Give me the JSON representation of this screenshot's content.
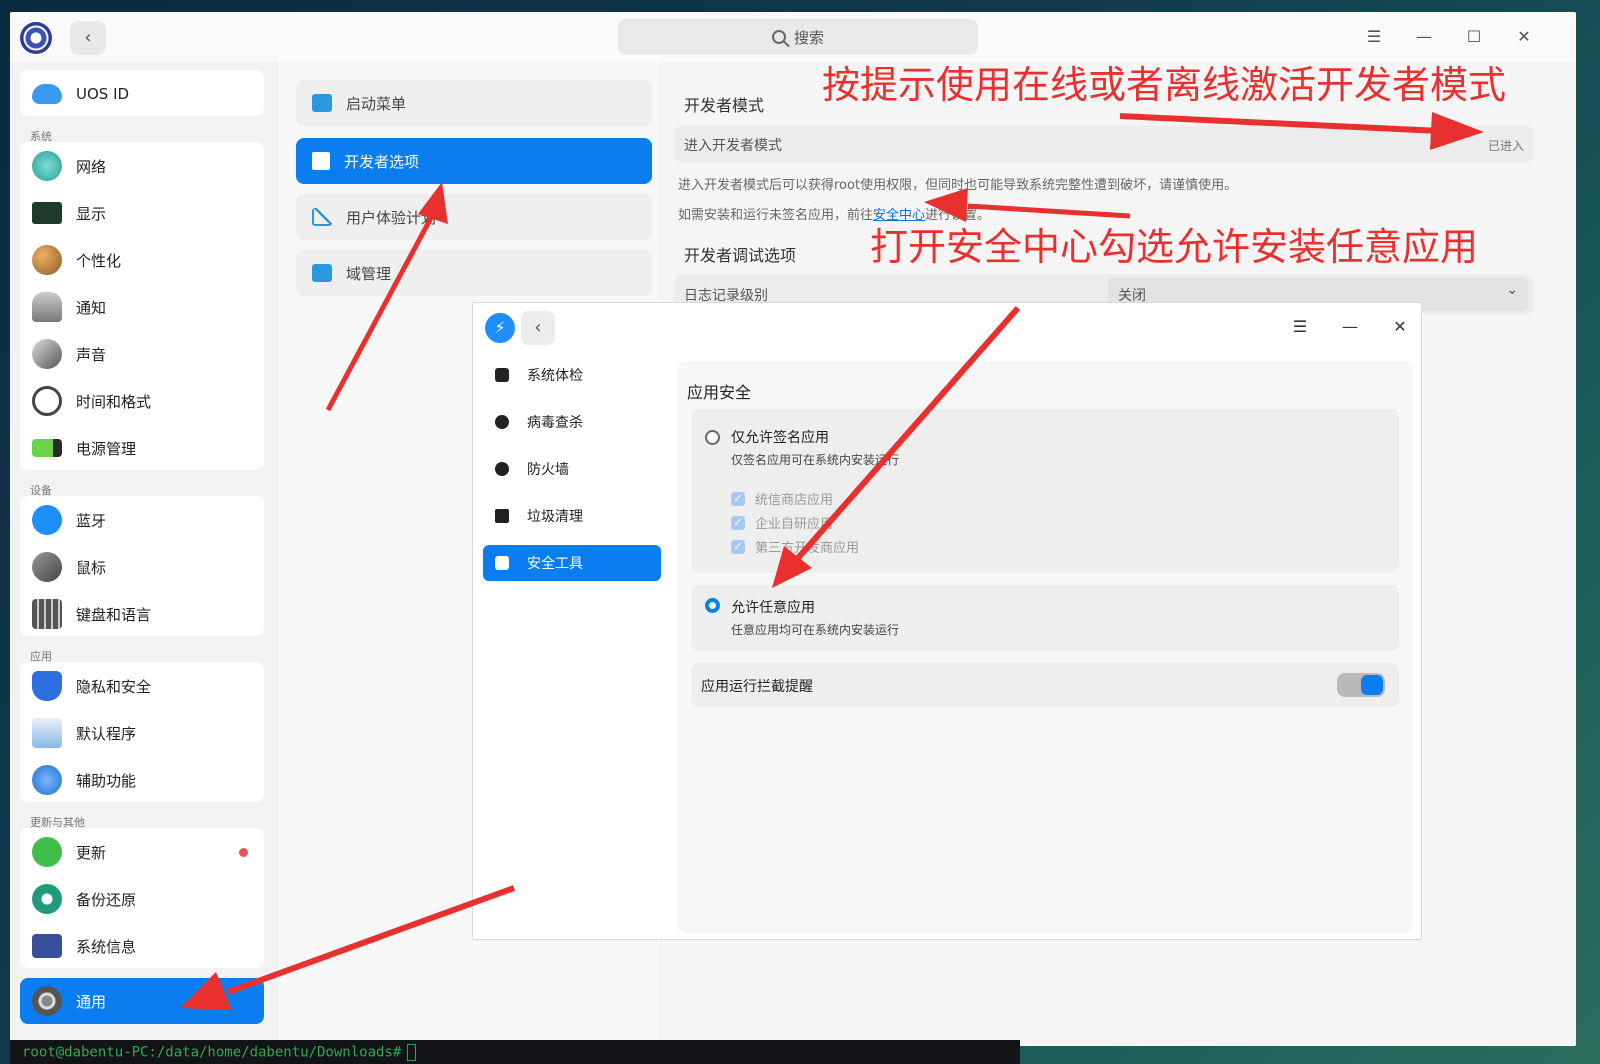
{
  "titlebar": {
    "back_label": "‹",
    "search_placeholder": "搜索"
  },
  "sidebar": {
    "top_item": "UOS ID",
    "sections": {
      "system": "系统",
      "device": "设备",
      "apps": "应用",
      "updates": "更新与其他"
    },
    "items": [
      "网络",
      "显示",
      "个性化",
      "通知",
      "声音",
      "时间和格式",
      "电源管理",
      "蓝牙",
      "鼠标",
      "键盘和语言",
      "隐私和安全",
      "默认程序",
      "辅助功能",
      "更新",
      "备份还原",
      "系统信息",
      "通用"
    ],
    "active": "通用"
  },
  "middle": {
    "items": [
      "启动菜单",
      "开发者选项",
      "用户体验计划",
      "域管理"
    ],
    "active": "开发者选项"
  },
  "content": {
    "dev_mode_title": "开发者模式",
    "enter_label": "进入开发者模式",
    "enter_status": "已进入",
    "hint1": "进入开发者模式后可以获得root使用权限，但同时也可能导致系统完整性遭到破坏，请谨慎使用。",
    "hint2_prefix": "如需安装和运行未签名应用，前往",
    "hint2_link": "安全中心",
    "hint2_suffix": "进行设置。",
    "debug_title": "开发者调试选项",
    "log_label": "日志记录级别",
    "log_value": "关闭"
  },
  "dialog": {
    "side_items": [
      "系统体检",
      "病毒查杀",
      "防火墙",
      "垃圾清理",
      "安全工具"
    ],
    "active": "安全工具",
    "title": "应用安全",
    "opt_signed_title": "仅允许签名应用",
    "opt_signed_sub": "仅签名应用可在系统内安装运行",
    "checkboxes": [
      "统信商店应用",
      "企业自研应用",
      "第三方开发商应用"
    ],
    "opt_any_title": "允许任意应用",
    "opt_any_sub": "任意应用均可在系统内安装运行",
    "intercept_label": "应用运行拦截提醒",
    "intercept_on": true
  },
  "annotations": {
    "top": "按提示使用在线或者离线激活开发者模式",
    "middle": "打开安全中心勾选允许安装任意应用"
  },
  "terminal": {
    "prompt": "root@dabentu-PC:/data/home/dabentu/Downloads#"
  },
  "colors": {
    "accent": "#0a7ef0",
    "annotation": "#e8312f"
  }
}
